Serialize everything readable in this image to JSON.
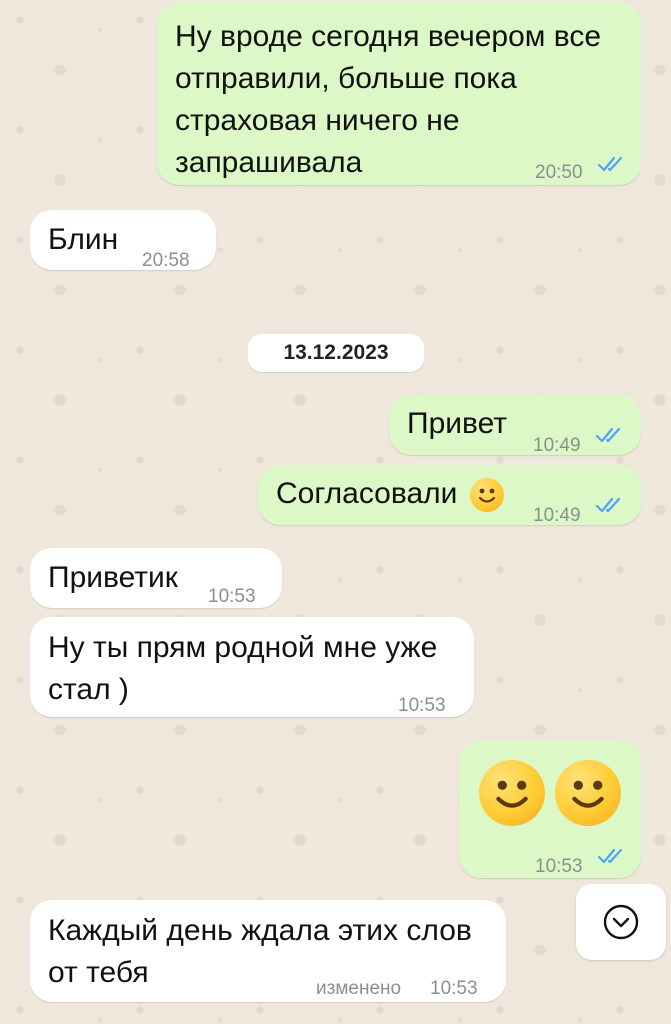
{
  "chat": {
    "messages": [
      {
        "direction": "outgoing",
        "text": "Ну вроде сегодня вечером все\nотправили, больше пока\nстраховая ничего не\nзапрашивала",
        "time": "20:50",
        "status": "read"
      },
      {
        "direction": "incoming",
        "text": "Блин",
        "time": "20:58"
      },
      {
        "direction": "outgoing",
        "text": "Привет",
        "time": "10:49",
        "status": "read"
      },
      {
        "direction": "outgoing",
        "text": "Согласовали",
        "time": "10:49",
        "status": "read",
        "emoji": "slightly-smiling-face"
      },
      {
        "direction": "incoming",
        "text": "Приветик",
        "time": "10:53"
      },
      {
        "direction": "incoming",
        "text": "Ну ты прям родной мне уже\nстал )",
        "time": "10:53"
      },
      {
        "direction": "outgoing",
        "text": "",
        "time": "10:53",
        "status": "read",
        "emoji": "slightly-smiling-face x2"
      },
      {
        "direction": "incoming",
        "text": "Каждый день ждала этих слов\nот тебя",
        "time": "10:53",
        "edited_label": "изменено"
      }
    ],
    "date_separator": "13.12.2023"
  },
  "colors": {
    "outgoing_bubble": "#dcf8c6",
    "incoming_bubble": "#ffffff",
    "read_ticks": "#4fa3f7",
    "wallpaper": "#efe7dc"
  },
  "icons": {
    "read_status": "double-check-icon",
    "scroll_down": "chevron-down-circle-icon",
    "emoji": "slightly-smiling-face-emoji"
  }
}
